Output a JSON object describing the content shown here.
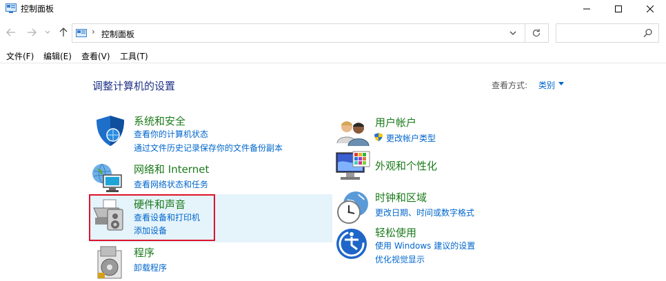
{
  "window": {
    "title": "控制面板"
  },
  "address": {
    "breadcrumb": "控制面板",
    "separator": "›",
    "search_placeholder": ""
  },
  "menu": {
    "items": [
      "文件(F)",
      "编辑(E)",
      "查看(V)",
      "工具(T)"
    ]
  },
  "main": {
    "heading": "调整计算机的设置",
    "view_by_label": "查看方式:",
    "view_by_value": "类别"
  },
  "categories_left": [
    {
      "title": "系统和安全",
      "links": [
        "查看你的计算机状态",
        "通过文件历史记录保存你的文件备份副本"
      ]
    },
    {
      "title": "网络和 Internet",
      "links": [
        "查看网络状态和任务"
      ]
    },
    {
      "title": "硬件和声音",
      "links": [
        "查看设备和打印机",
        "添加设备"
      ]
    },
    {
      "title": "程序",
      "links": [
        "卸载程序"
      ]
    }
  ],
  "categories_right": [
    {
      "title": "用户帐户",
      "links": [
        "更改帐户类型"
      ]
    },
    {
      "title": "外观和个性化",
      "links": []
    },
    {
      "title": "时钟和区域",
      "links": [
        "更改日期、时间或数字格式"
      ]
    },
    {
      "title": "轻松使用",
      "links": [
        "使用 Windows 建议的设置",
        "优化视觉显示"
      ]
    }
  ],
  "colors": {
    "heading": "#1e3287",
    "category_title": "#1a7a1a",
    "link": "#0066cc",
    "highlight": "#e5f3fb",
    "red_box": "#e0102a"
  }
}
